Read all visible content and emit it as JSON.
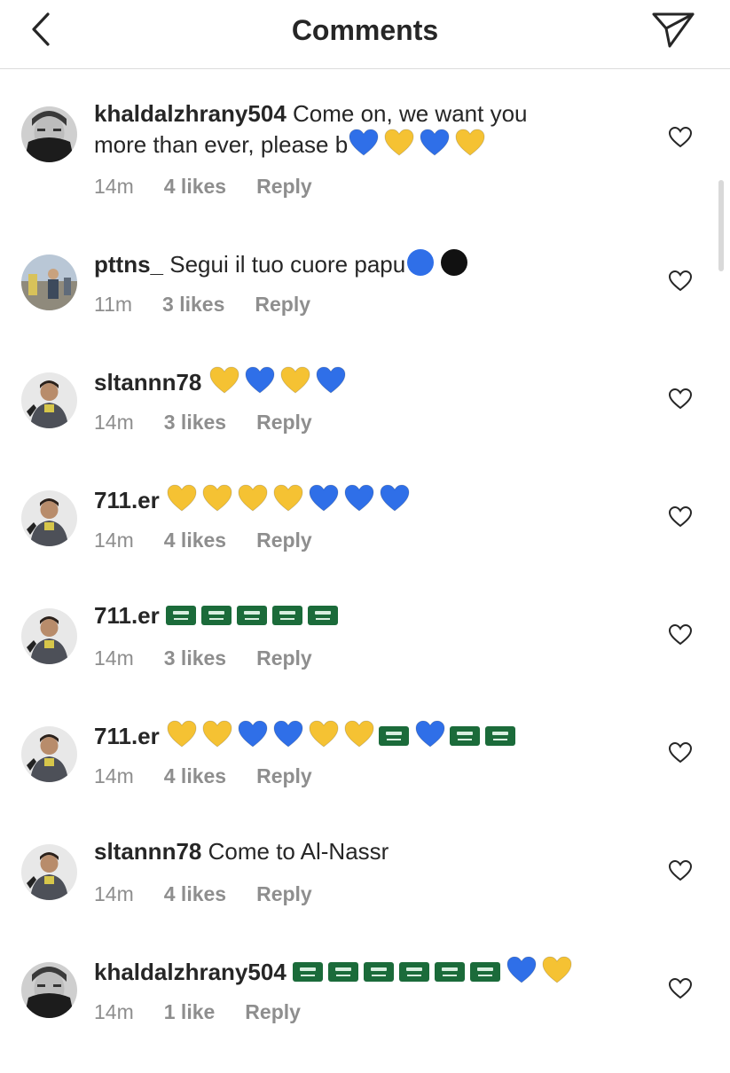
{
  "header": {
    "title": "Comments",
    "back_icon": "chevron-left-icon",
    "share_icon": "paper-plane-icon"
  },
  "colors": {
    "blue_heart": "#2f6fe8",
    "yellow_heart": "#f5c233",
    "flag_green": "#1b6b3a",
    "meta_gray": "#8e8e8e",
    "text": "#262626"
  },
  "comments": [
    {
      "username": "khaldalzhrany504",
      "text_line1": "Come on, we want you",
      "text_line2": "more than ever, please b",
      "emojis": [
        "blue-heart",
        "yellow-heart",
        "blue-heart",
        "yellow-heart"
      ],
      "time": "14m",
      "likes": "4 likes",
      "reply": "Reply"
    },
    {
      "username": "pttns_",
      "text_line1": "Segui il tuo cuore papu",
      "emojis": [
        "blue-circle",
        "black-circle"
      ],
      "time": "11m",
      "likes": "3 likes",
      "reply": "Reply"
    },
    {
      "username": "sltannn78",
      "text_line1": "",
      "emojis": [
        "yellow-heart",
        "blue-heart",
        "yellow-heart",
        "blue-heart"
      ],
      "time": "14m",
      "likes": "3 likes",
      "reply": "Reply"
    },
    {
      "username": "711.er",
      "text_line1": "",
      "emojis": [
        "yellow-heart",
        "yellow-heart",
        "yellow-heart",
        "yellow-heart",
        "blue-heart",
        "blue-heart",
        "blue-heart"
      ],
      "time": "14m",
      "likes": "4 likes",
      "reply": "Reply"
    },
    {
      "username": "711.er",
      "text_line1": "",
      "emojis": [
        "saudi-flag",
        "saudi-flag",
        "saudi-flag",
        "saudi-flag",
        "saudi-flag"
      ],
      "time": "14m",
      "likes": "3 likes",
      "reply": "Reply"
    },
    {
      "username": "711.er",
      "text_line1": "",
      "emojis": [
        "yellow-heart",
        "yellow-heart",
        "blue-heart",
        "blue-heart",
        "yellow-heart",
        "yellow-heart",
        "saudi-flag",
        "blue-heart",
        "saudi-flag",
        "saudi-flag"
      ],
      "time": "14m",
      "likes": "4 likes",
      "reply": "Reply"
    },
    {
      "username": "sltannn78",
      "text_line1": "Come to Al-Nassr",
      "emojis": [],
      "time": "14m",
      "likes": "4 likes",
      "reply": "Reply"
    },
    {
      "username": "khaldalzhrany504",
      "text_line1": "",
      "emojis": [
        "saudi-flag",
        "saudi-flag",
        "saudi-flag",
        "saudi-flag",
        "saudi-flag",
        "saudi-flag",
        "blue-heart",
        "yellow-heart"
      ],
      "time": "14m",
      "likes": "1 like",
      "reply": "Reply"
    }
  ]
}
